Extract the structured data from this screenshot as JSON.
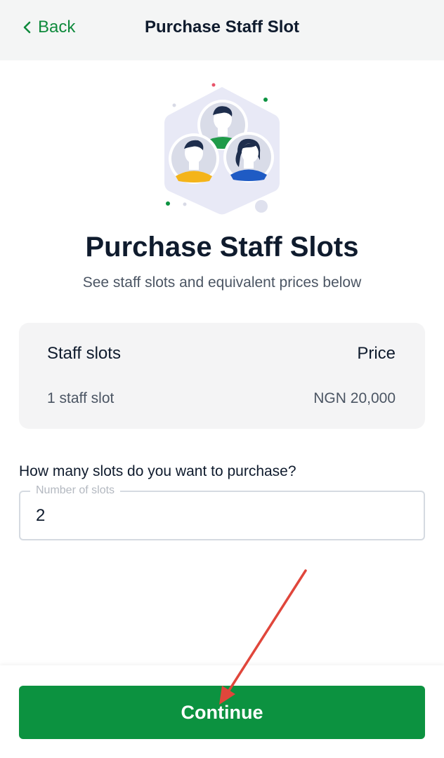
{
  "header": {
    "back_label": "Back",
    "title": "Purchase Staff Slot"
  },
  "main": {
    "title": "Purchase Staff Slots",
    "subtitle": "See staff slots and equivalent prices below"
  },
  "price_table": {
    "columns": [
      "Staff slots",
      "Price"
    ],
    "rows": [
      [
        "1 staff slot",
        "NGN 20,000"
      ]
    ]
  },
  "slots_field": {
    "question": "How many slots do you want to purchase?",
    "label": "Number of slots",
    "value": "2"
  },
  "footer": {
    "continue_label": "Continue"
  },
  "colors": {
    "accent": "#0c9240",
    "header_bg": "#f4f5f5",
    "card_bg": "#f4f4f5",
    "annotation_arrow": "#e0463b"
  }
}
